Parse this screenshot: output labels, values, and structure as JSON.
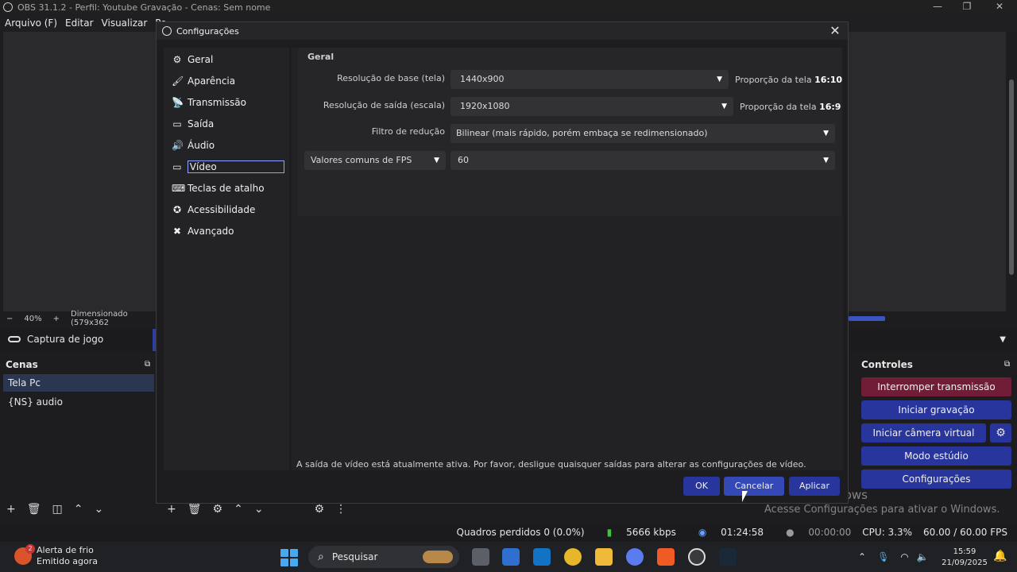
{
  "window": {
    "title": "OBS 31.1.2 - Perfil: Youtube Gravação - Cenas: Sem nome",
    "minimize": "—",
    "maximize": "❐",
    "close": "✕"
  },
  "menu": [
    "Arquivo (F)",
    "Editar",
    "Visualizar",
    "Pe"
  ],
  "preview": {
    "zoom_minus": "−",
    "zoom_value": "40%",
    "zoom_plus": "+",
    "scale_text": "Dimensionado (579x362"
  },
  "source": {
    "name": "Captura de jogo"
  },
  "scenes": {
    "title": "Cenas",
    "items": [
      "Tela Pc",
      "{NS} audio"
    ]
  },
  "controls": {
    "title": "Controles",
    "stop_stream": "Interromper transmissão",
    "start_recording": "Iniciar gravação",
    "start_virtual_cam": "Iniciar câmera virtual",
    "studio_mode": "Modo estúdio",
    "settings": "Configurações"
  },
  "status": {
    "dropped_frames": "Quadros perdidos 0 (0.0%)",
    "bitrate": "5666 kbps",
    "stream_time": "01:24:58",
    "rec_time": "00:00:00",
    "cpu": "CPU: 3.3%",
    "fps": "60.00 / 60.00 FPS"
  },
  "watermark": {
    "line1": "Ativar o Windows",
    "line2": "Acesse Configurações para ativar o Windows."
  },
  "dialog": {
    "title": "Configurações",
    "close": "✕",
    "nav": [
      {
        "label": "Geral",
        "icon": "gear-icon"
      },
      {
        "label": "Aparência",
        "icon": "palette-icon"
      },
      {
        "label": "Transmissão",
        "icon": "antenna-icon"
      },
      {
        "label": "Saída",
        "icon": "output-icon"
      },
      {
        "label": "Áudio",
        "icon": "speaker-icon"
      },
      {
        "label": "Vídeo",
        "icon": "monitor-icon"
      },
      {
        "label": "Teclas de atalho",
        "icon": "keyboard-icon"
      },
      {
        "label": "Acessibilidade",
        "icon": "accessibility-icon"
      },
      {
        "label": "Avançado",
        "icon": "tools-icon"
      }
    ],
    "selected_nav": "Vídeo",
    "group_title": "Geral",
    "base_res_label": "Resolução de base (tela)",
    "base_res_value": "1440x900",
    "base_ratio_prefix": "Proporção da tela",
    "base_ratio_value": "16:10",
    "output_res_label": "Resolução de saída (escala)",
    "output_res_value": "1920x1080",
    "output_ratio_prefix": "Proporção da tela",
    "output_ratio_value": "16:9",
    "filter_label": "Filtro de redução",
    "filter_value": "Bilinear (mais rápido, porém embaça se redimensionado)",
    "fps_type_value": "Valores comuns de FPS",
    "fps_value": "60",
    "warning": "A saída de vídeo está atualmente ativa. Por favor, desligue quaisquer saídas para alterar as configurações de vídeo.",
    "ok": "OK",
    "cancel": "Cancelar",
    "apply": "Aplicar"
  },
  "taskbar": {
    "notif_title": "Alerta de frio",
    "notif_sub": "Emitido agora",
    "notif_badge": "2",
    "search_placeholder": "Pesquisar",
    "time": "15:59",
    "date": "21/09/2025"
  },
  "colors": {
    "accent_blue": "#28359c",
    "stop_red": "#721d38",
    "selected_border": "#8fa4ff"
  }
}
